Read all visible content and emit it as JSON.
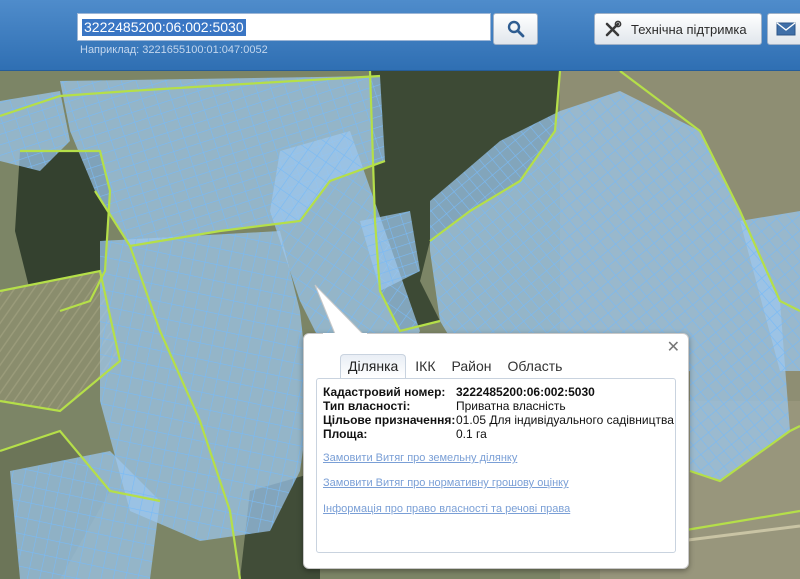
{
  "search": {
    "value": "3222485200:06:002:5030",
    "hint": "Наприклад: 3221655100:01:047:0052"
  },
  "header": {
    "support_label": "Технічна підтримка"
  },
  "popup": {
    "tabs": [
      "Ділянка",
      "ІКК",
      "Район",
      "Область"
    ],
    "active_tab": "Ділянка",
    "fields": [
      {
        "label": "Кадастровий номер:",
        "value": "3222485200:06:002:5030"
      },
      {
        "label": "Тип власності:",
        "value": "Приватна власність"
      },
      {
        "label": "Цільове призначення:",
        "value": "01.05 Для індивідуального садівництва"
      },
      {
        "label": "Площа:",
        "value": "0.1 га"
      }
    ],
    "links": [
      "Замовити Витяг про земельну ділянку",
      "Замовити Витяг про нормативну грошову оцінку",
      "Інформація про право власності та речові права"
    ]
  },
  "colors": {
    "header": "#3b7cc0",
    "parcel_fill": "#9cc7ee",
    "parcel_stroke": "#6fb3ff",
    "boundary": "#b8e04a",
    "link": "#7a9fd6"
  },
  "icons": {
    "search": "search-icon",
    "support": "tools-icon",
    "mail": "mail-icon",
    "close": "close-icon"
  }
}
